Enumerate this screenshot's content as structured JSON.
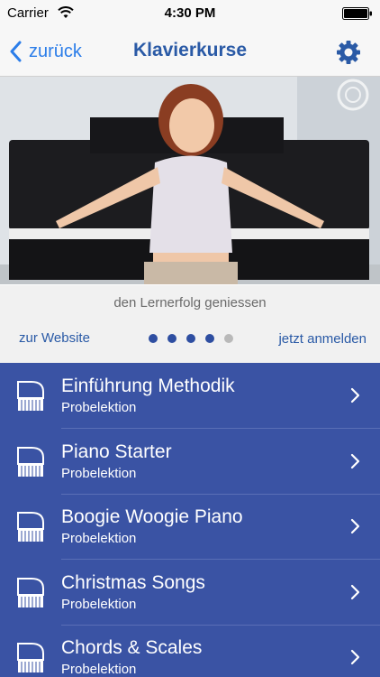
{
  "status_bar": {
    "carrier": "Carrier",
    "time": "4:30 PM"
  },
  "nav": {
    "back_label": "zurück",
    "title": "Klavierkurse"
  },
  "hero": {
    "caption": "den Lernerfolg geniessen"
  },
  "links": {
    "website": "zur Website",
    "signup": "jetzt anmelden"
  },
  "pager": {
    "total": 5,
    "active": 4
  },
  "courses": [
    {
      "title": "Einführung Methodik",
      "subtitle": "Probelektion"
    },
    {
      "title": "Piano Starter",
      "subtitle": "Probelektion"
    },
    {
      "title": "Boogie Woogie Piano",
      "subtitle": "Probelektion"
    },
    {
      "title": "Christmas Songs",
      "subtitle": "Probelektion"
    },
    {
      "title": "Chords & Scales",
      "subtitle": "Probelektion"
    }
  ],
  "icons": {
    "wifi": "wifi-icon",
    "battery": "battery-icon",
    "back": "chevron-left-icon",
    "settings": "gear-icon",
    "course": "grand-piano-icon",
    "disclosure": "chevron-right-icon"
  },
  "colors": {
    "accent": "#2b7de9",
    "title": "#2a5aa6",
    "list_bg": "#3a53a4",
    "dot_active": "#2e4ea1",
    "dot_inactive": "#b9b9b9"
  }
}
